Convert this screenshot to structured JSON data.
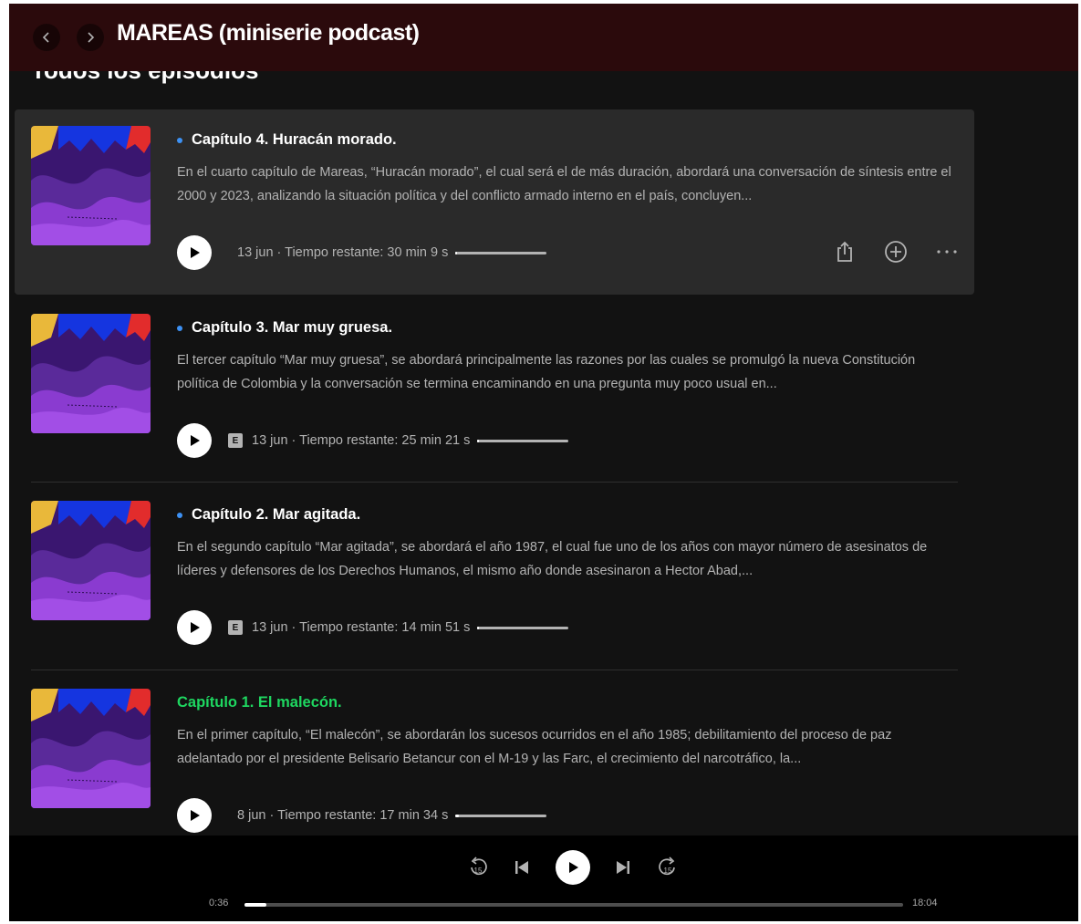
{
  "header": {
    "title": "MAREAS (miniserie podcast)",
    "back_icon": "chevron-left-icon",
    "forward_icon": "chevron-right-icon"
  },
  "section": {
    "heading": "Todos los episodios"
  },
  "episodes": [
    {
      "title": "Capítulo 4. Huracán morado.",
      "description": "En el cuarto capítulo de Mareas, “Huracán morado”, el cual será el de más duración, abordará una conversación de síntesis entre el 2000 y 2023, analizando la situación política y del conflicto armado interno en el país, concluyen...",
      "meta": "13 jun · Tiempo restante: 30 min 9 s",
      "progress": 0.02,
      "explicit": false,
      "explicit_label": "",
      "new": true,
      "hovered": true
    },
    {
      "title": "Capítulo 3. Mar muy gruesa.",
      "description": "El tercer capítulo “Mar muy gruesa”, se abordará principalmente las razones por las cuales se promulgó la nueva Constitución política de Colombia y la conversación se termina encaminando en una pregunta muy poco usual en...",
      "meta": "13 jun · Tiempo restante: 25 min 21 s",
      "progress": 0.02,
      "explicit": true,
      "explicit_label": "E",
      "new": true,
      "hovered": false
    },
    {
      "title": "Capítulo 2. Mar agitada.",
      "description": "En el segundo capítulo “Mar agitada”, se abordará el año 1987, el cual fue uno de los años con mayor número de asesinatos de líderes y defensores de los Derechos Humanos, el mismo año donde asesinaron a Hector Abad,...",
      "meta": "13 jun · Tiempo restante: 14 min 51 s",
      "progress": 0.02,
      "explicit": true,
      "explicit_label": "E",
      "new": true,
      "hovered": false
    },
    {
      "title": "Capítulo 1. El malecón.",
      "description": "En el primer capítulo, “El malecón”,  se abordarán los sucesos ocurridos en el año 1985; debilitamiento del proceso de paz adelantado por el presidente Belisario Betancur con el M-19 y las Farc, el crecimiento del narcotráfico, la...",
      "meta": "8 jun · Tiempo restante: 17 min 34 s",
      "progress": 0.04,
      "explicit": false,
      "explicit_label": "",
      "new": false,
      "hovered": false
    }
  ],
  "row_actions": {
    "share_icon": "share-icon",
    "add_icon": "add-circle-icon",
    "more_icon": "more-icon"
  },
  "player": {
    "elapsed": "0:36",
    "total": "18:04",
    "progress": 0.033,
    "skip_back_label": "15",
    "skip_forward_label": "15"
  },
  "colors": {
    "header_bg": "#2b0a0c",
    "background": "#121212",
    "hover_bg": "#2a2a2a",
    "new_dot": "#3d91f4",
    "playing_title": "#1ed760"
  }
}
